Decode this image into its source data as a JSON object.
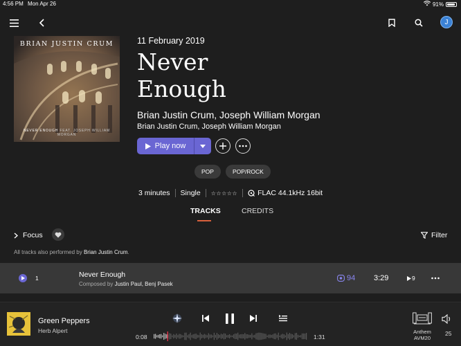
{
  "status_bar": {
    "time": "4:56 PM",
    "date": "Mon Apr 26",
    "battery": "91%",
    "battery_level": 0.91
  },
  "nav": {
    "icons": [
      "menu-icon",
      "back-icon",
      "bookmark-icon",
      "search-icon"
    ],
    "avatar_initial": "J"
  },
  "album": {
    "cover_artist": "BRIAN JUSTIN CRUM",
    "cover_title": "NEVER ENOUGH",
    "cover_feat": "FEAT. JOSEPH WILLIAM MORGAN",
    "release_date": "11 February 2019",
    "title_line1": "Never",
    "title_line2": "Enough",
    "artists_primary": "Brian Justin Crum, Joseph William Morgan",
    "artists_secondary": "Brian Justin Crum, Joseph William Morgan"
  },
  "actions": {
    "play_label": "Play now"
  },
  "genres": [
    "POP",
    "POP/ROCK"
  ],
  "meta": {
    "duration": "3 minutes",
    "type": "Single",
    "stars": "☆☆☆☆☆",
    "quality": "FLAC 44.1kHz 16bit"
  },
  "tabs": {
    "tracks": "TRACKS",
    "credits": "CREDITS"
  },
  "focus": {
    "label": "Focus",
    "filter_label": "Filter"
  },
  "note": {
    "prefix": "All tracks also performed by ",
    "performer": "Brian Justin Crum",
    "suffix": "."
  },
  "track": {
    "number": "1",
    "title": "Never Enough",
    "composer_prefix": "Composed by ",
    "composers": "Justin Paul, Benj Pasek",
    "popularity": "94",
    "duration": "3:29",
    "play_count": "9"
  },
  "player": {
    "title": "Green Peppers",
    "artist": "Herb Alpert",
    "elapsed": "0:08",
    "total": "1:31",
    "progress": 0.088,
    "device_line1": "Anthem",
    "device_line2": "AVM20",
    "volume": "25"
  },
  "colors": {
    "accent": "#6a66d3",
    "tab_underline": "#d9613d",
    "background": "#1e1e1e"
  }
}
